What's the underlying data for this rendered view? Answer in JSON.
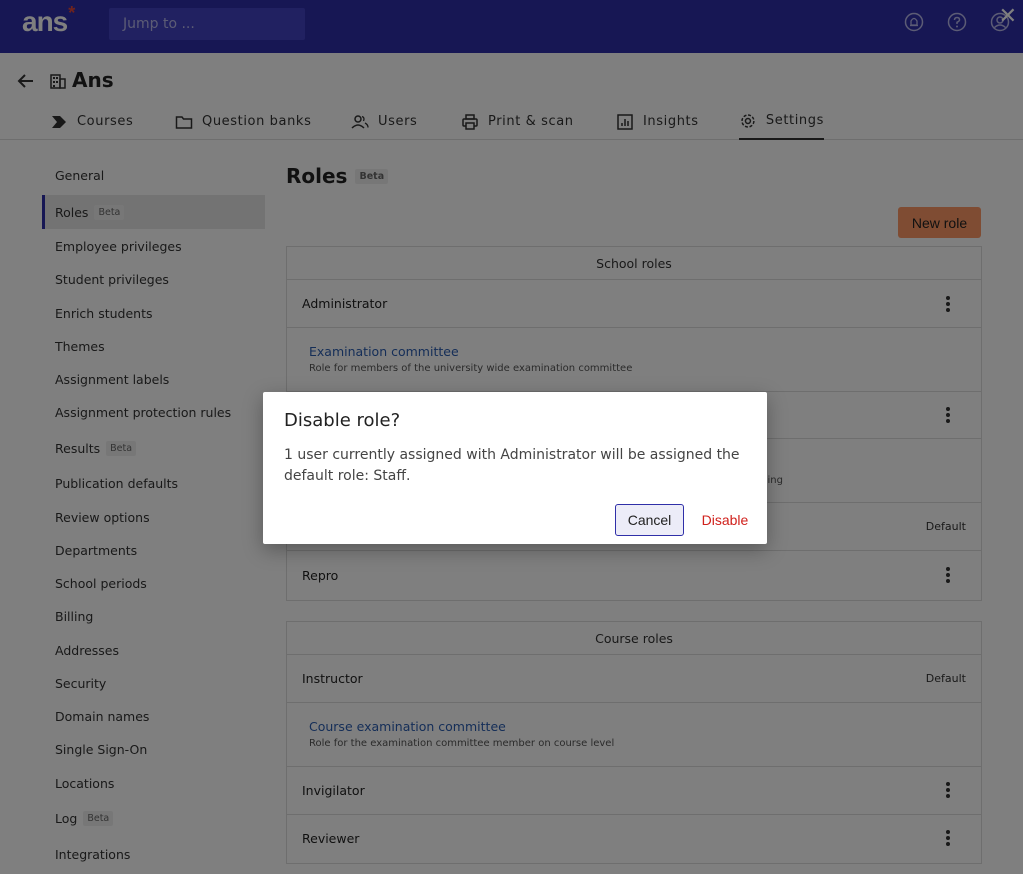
{
  "topbar": {
    "logo": "ans",
    "logo_star": "*",
    "search_placeholder": "Jump to ...",
    "icons": [
      "notification-icon",
      "help-icon",
      "account-icon"
    ],
    "close_glyph": "✕"
  },
  "header": {
    "title": "Ans"
  },
  "tabs": [
    {
      "label": "Courses",
      "icon": "courses-icon"
    },
    {
      "label": "Question banks",
      "icon": "folder-icon"
    },
    {
      "label": "Users",
      "icon": "users-icon"
    },
    {
      "label": "Print & scan",
      "icon": "printer-icon"
    },
    {
      "label": "Insights",
      "icon": "insights-icon"
    },
    {
      "label": "Settings",
      "icon": "gear-icon"
    }
  ],
  "sidebar": {
    "items": [
      {
        "label": "General"
      },
      {
        "label": "Roles",
        "badge": "Beta"
      },
      {
        "label": "Employee privileges"
      },
      {
        "label": "Student privileges"
      },
      {
        "label": "Enrich students"
      },
      {
        "label": "Themes"
      },
      {
        "label": "Assignment labels"
      },
      {
        "label": "Assignment protection rules"
      },
      {
        "label": "Results",
        "badge": "Beta"
      },
      {
        "label": "Publication defaults"
      },
      {
        "label": "Review options"
      },
      {
        "label": "Departments"
      },
      {
        "label": "School periods"
      },
      {
        "label": "Billing"
      },
      {
        "label": "Addresses"
      },
      {
        "label": "Security"
      },
      {
        "label": "Domain names"
      },
      {
        "label": "Single Sign-On"
      },
      {
        "label": "Locations"
      },
      {
        "label": "Log",
        "badge": "Beta"
      },
      {
        "label": "Integrations"
      }
    ]
  },
  "main": {
    "title": "Roles",
    "title_badge": "Beta",
    "new_role_label": "New role",
    "school_roles": {
      "heading": "School roles",
      "rows": [
        {
          "label": "Administrator"
        },
        {
          "sub_label": "Examination committee",
          "sub_desc": "Role for members of the university wide examination committee"
        },
        {
          "label": ""
        },
        {
          "sub_desc_fragment": "ing"
        },
        {
          "default": "Default"
        },
        {
          "label": "Repro"
        }
      ]
    },
    "course_roles": {
      "heading": "Course roles",
      "rows": [
        {
          "label": "Instructor",
          "default": "Default"
        },
        {
          "sub_label": "Course examination committee",
          "sub_desc": "Role for the examination committee member on course level"
        },
        {
          "label": "Invigilator"
        },
        {
          "label": "Reviewer"
        }
      ]
    }
  },
  "modal": {
    "title": "Disable role?",
    "body": "1 user currently assigned with Administrator will be assigned the default role: Staff.",
    "cancel_label": "Cancel",
    "disable_label": "Disable"
  },
  "colors": {
    "topbar": "#2f2fa8",
    "accent_button": "#ff9966",
    "link": "#2a5db0",
    "danger": "#d0211c"
  }
}
